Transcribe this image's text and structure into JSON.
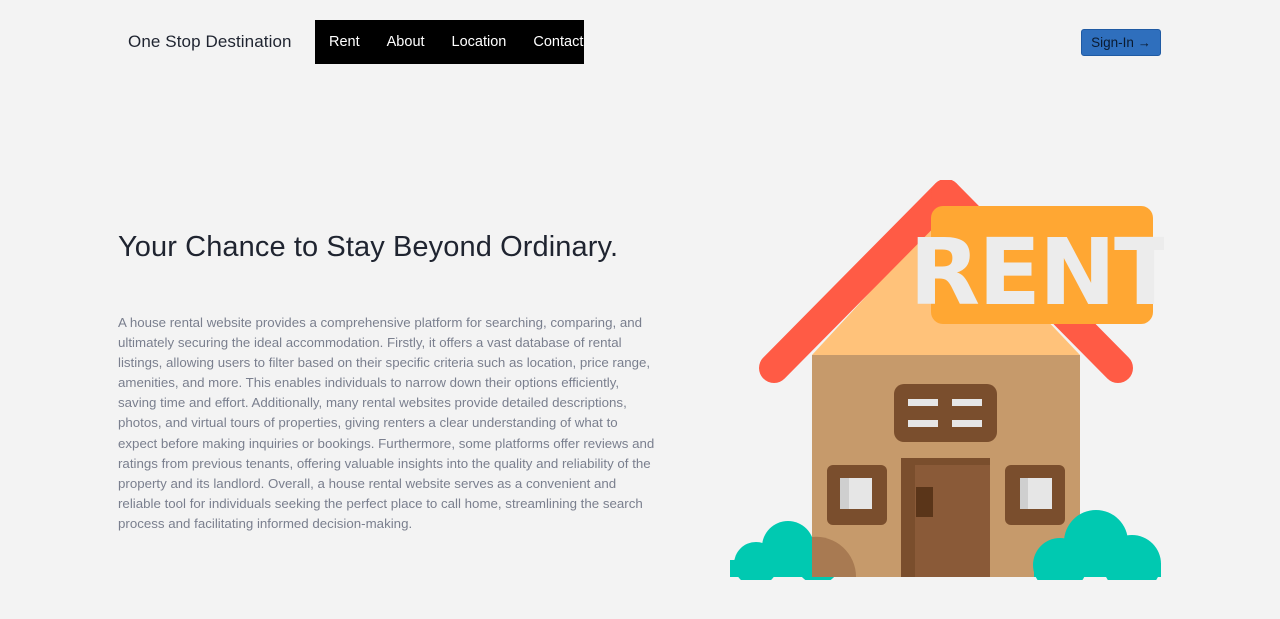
{
  "header": {
    "brand": "One Stop Destination",
    "nav": {
      "rent": "Rent",
      "about": "About",
      "location": "Location",
      "contact": "Contact"
    },
    "signin_label": "Sign-In",
    "signin_icon": "arrow-right-icon"
  },
  "hero": {
    "title": "Your Chance to Stay Beyond Ordinary.",
    "description": "A house rental website provides a comprehensive platform for searching, comparing, and ultimately securing the ideal accommodation. Firstly, it offers a vast database of rental listings, allowing users to filter based on their specific criteria such as location, price range, amenities, and more. This enables individuals to narrow down their options efficiently, saving time and effort. Additionally, many rental websites provide detailed descriptions, photos, and virtual tours of properties, giving renters a clear understanding of what to expect before making inquiries or bookings. Furthermore, some platforms offer reviews and ratings from previous tenants, offering valuable insights into the quality and reliability of the property and its landlord. Overall, a house rental website serves as a convenient and reliable tool for individuals seeking the perfect place to call home, streamlining the search process and facilitating informed decision-making.",
    "illustration": {
      "icon": "house-rent-illustration",
      "sign_text": "RENT"
    }
  },
  "colors": {
    "background": "#f3f3f3",
    "nav_bg": "#000000",
    "signin_bg": "#2f6fbd",
    "roof": "#ff5b45",
    "sign": "#ffa733",
    "wall": "#c69a6b",
    "bush": "#00c9b1"
  }
}
